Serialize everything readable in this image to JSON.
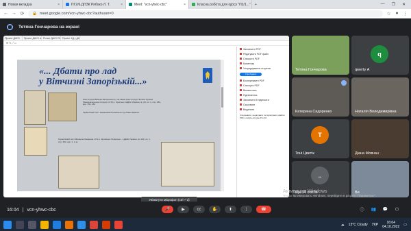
{
  "tabs": [
    {
      "label": "Новая вкладка",
      "color": "#5f6368"
    },
    {
      "label": "ПГ2/6.ДПЗК Рябоко Л. Т.",
      "color": "#1a73e8"
    },
    {
      "label": "Meet: \"vcn-yhwc-cbc\"",
      "color": "#00897b"
    },
    {
      "label": "Класна робота для курсу \"П2/1...\"",
      "color": "#34a853"
    }
  ],
  "address": "meet.google.com/vcn-yhwc-cbc?authuser=0",
  "banner": "Тетяна Гончарова на екрані",
  "pdf": {
    "tabs": [
      "Проект ДАСЗ",
      "Проект ДАСЗ пієса",
      "Proэкт ДАСЗ Ппан",
      "Проект 1Д у ДАСЗ"
    ],
    "title_line1": "«... Дбати про лад",
    "title_line2": "у Вітчизні Запорізькій...»",
    "text1": "Конституція Війська Запорозького, так звана Конституція Пилипа Орлика (Бендерська конституція). 1710 р. Оригінал. ЦДІАК України, ф. 20, оп. 1, спр. 284, арк. 159, 184",
    "text2": "Гарантійний лист Нахманова Рязанського до Івана Мазепи",
    "text3": "Гарантійний лист Михаила Захарина 1711 р. Кримсько-Татарське... ЦДІАК України, ф. 229, оп. 1, спр. 460, арк. 1, 1 зв.",
    "side": [
      "Заповнити PDF",
      "Редагувати PDF файл",
      "Створити PDF",
      "Коментар",
      "Упорядкування сторінок",
      "Експортувати PDF",
      "Стиснути PDF",
      "Впевнитись",
      "Підписатись",
      "Заповнити й підписати",
      "Скасувати",
      "Видалити"
    ],
    "side_button": "Спробувати",
    "side_note": "Створювати, редагувати та підписувати файли PDF в Adobe Acrobat Pro DC"
  },
  "participants": [
    {
      "name": "Тетяна Гончарова",
      "color": "#7ba05b"
    },
    {
      "name": "qwerty А",
      "initial": "q",
      "color": "#1e8e3e"
    },
    {
      "name": "Катерина Сидоренко",
      "color": "#5e5a55"
    },
    {
      "name": "Наталія Володимирівна",
      "color": "#6b6560"
    },
    {
      "name": "Тоні Цветік",
      "initial": "Т",
      "color": "#e37400"
    },
    {
      "name": "Діана Мовчан",
      "color": "#4a3c30"
    },
    {
      "name": "Ще 34 особи",
      "initial": "..",
      "color": "#3c4043"
    },
    {
      "name": "Ви",
      "color": "#7d8a9a"
    }
  ],
  "tooltip": "Увімкнути мікрофон (ctrl + d)",
  "meet_code": "vcn-yhwc-cbc",
  "clock": "16:04",
  "activation_title": "Активация Windows",
  "activation_text": "Чтобы активировать Windows, перейдите в раздел \"Параметры\".",
  "weather": "13°C Cloudy",
  "lang": "УКР",
  "tray_time": "16:04",
  "tray_date": "04.10.2022"
}
